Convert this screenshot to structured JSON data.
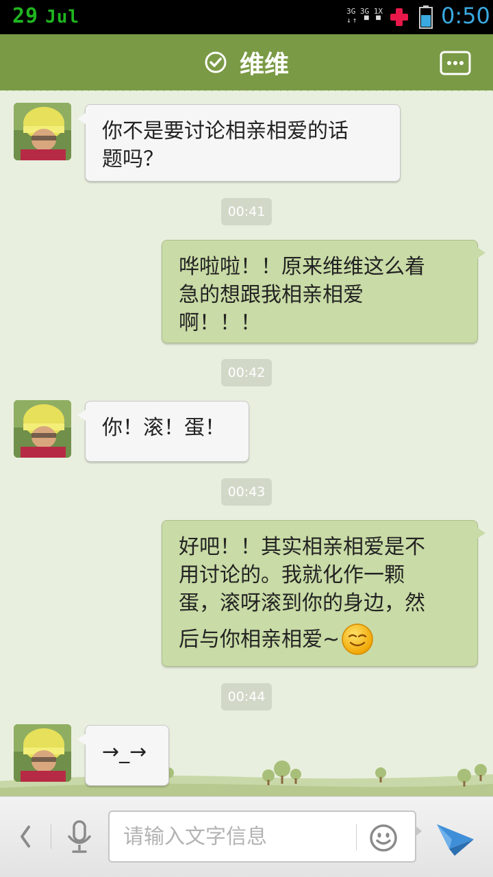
{
  "status_bar": {
    "day": "29",
    "month": "Jul",
    "network_labels": [
      "3G",
      "3G",
      "1X"
    ],
    "time": "0:50",
    "icons": [
      "signal-icon",
      "plus-cross-icon",
      "battery-icon"
    ]
  },
  "header": {
    "title": "维维",
    "verified_icon": "check-circle-icon",
    "more_icon": "more-dots-icon"
  },
  "messages": [
    {
      "side": "left",
      "lines": [
        "你不是要讨论相亲相爱的话",
        "题吗？"
      ]
    },
    {
      "type": "time",
      "text": "00:41"
    },
    {
      "side": "right",
      "lines": [
        "哗啦啦！！原来维维这么着",
        "急的想跟我相亲相爱",
        "啊！！！"
      ]
    },
    {
      "type": "time",
      "text": "00:42"
    },
    {
      "side": "left",
      "lines": [
        "你！滚！蛋！"
      ]
    },
    {
      "type": "time",
      "text": "00:43"
    },
    {
      "side": "right",
      "lines": [
        "好吧！！其实相亲相爱是不",
        "用讨论的。我就化作一颗",
        "蛋，滚呀滚到你的身边，然",
        "后与你相亲相爱~"
      ],
      "emoji": "smile-emoji-icon"
    },
    {
      "type": "time",
      "text": "00:44"
    },
    {
      "side": "left",
      "lines": [
        "→_→"
      ]
    }
  ],
  "input_bar": {
    "placeholder": "请输入文字信息",
    "icons": [
      "chevron-left-icon",
      "microphone-icon",
      "emoji-face-icon",
      "send-plane-icon"
    ]
  },
  "colors": {
    "header": "#7a9a45",
    "background": "#e9efde",
    "bubble_right": "#c9dba6",
    "bubble_left": "#f6f6f6",
    "time_accent": "#3aa9e0",
    "date_accent": "#1fb51f"
  }
}
